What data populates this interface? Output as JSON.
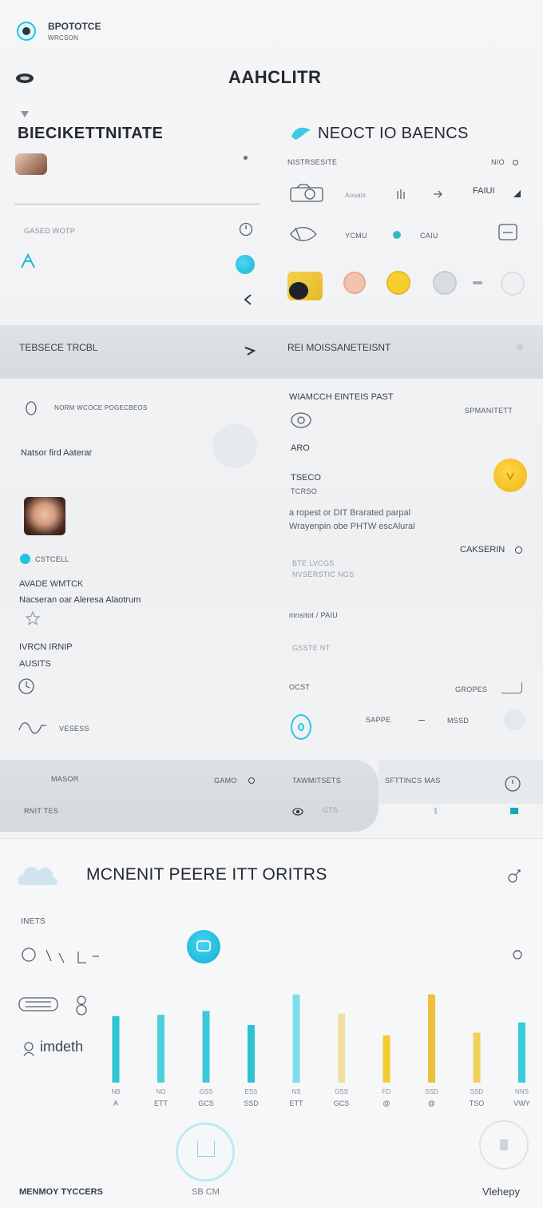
{
  "app": {
    "logo_title": "BPOTOTCE",
    "logo_subtitle": "WRCSON",
    "window_title": "AAHCLITR"
  },
  "left_panel": {
    "title": "BIECIKETTNITATE",
    "row1_label": "GASED WOTP",
    "band_label": "TEBSECE TRCBL",
    "row_a_label": "NORM WCOCE POGECBEOS",
    "section_label": "Natsor fird Aaterar",
    "status_label": "CSTCELL",
    "item_title": "AVADE WMTCK",
    "item_desc": "Nacseran oar Aleresa Alaotrum",
    "group_title": "IVRCN IRNIP",
    "group_sub": "AUSITS",
    "wave_label": "VESESS"
  },
  "right_panel": {
    "title": "NEOCT IO BAENCS",
    "header_left": "NISTRSESITE",
    "header_right": "NIO",
    "row1_mid": "Aouals",
    "row1_right": "FAIUI",
    "row2_mid": "YCMU",
    "row2_right": "CAIU",
    "band_label": "REI MOISSANETEISNT",
    "section_title": "WIAMCCH EINTEIS PAST",
    "section_right": "SPMANITETT",
    "sub1": "ARO",
    "sub2": "TSECO",
    "sub2b": "TCRSO",
    "desc_line1": "a ropest or DIT Brarated parpal",
    "desc_line2": "Wrayenpin obe PHTW escAlural",
    "status_right": "CAKSERIN",
    "note1": "BTE LVCGS",
    "note1b": "NVSERSTIC NGS",
    "note2": "mnsitot / PAIU",
    "note3": "GSSTE NT",
    "footer_left": "OCST",
    "footer_right": "GROPES",
    "action1": "SAPPE",
    "action2": "MSSD"
  },
  "bottom_bar": {
    "left_label": "MASOR",
    "left_value": "GAMO",
    "left_sub": "RNIT TES",
    "mid_label": "TAWMITSETS",
    "mid_sub": "GTS",
    "right_label": "SFTTINCS MAS"
  },
  "report": {
    "title": "MCNENIT PEERE ITT ORITRS",
    "section_label": "INETS",
    "legend_label": "imdeth",
    "footer_left": "MENMOY TYCCERS",
    "footer_mid": "SB CM",
    "footer_right": "Vlehepy"
  },
  "chart_data": {
    "type": "bar",
    "categories": [
      "NB",
      "NO",
      "GSS",
      "ESS",
      "NS",
      "GSS",
      "FD",
      "SSD",
      "SSD",
      "NNS"
    ],
    "categories_sub": [
      "A",
      "ETT",
      "GCS",
      "SSD",
      "ETT",
      "GCS",
      "@",
      "@",
      "TSO",
      "VWY"
    ],
    "values": [
      52,
      53,
      56,
      45,
      69,
      54,
      37,
      69,
      39,
      47
    ],
    "ylim": [
      0,
      100
    ],
    "colors": [
      "#2cc6d4",
      "#4bcfdc",
      "#3ac9d6",
      "#2cc2d0",
      "#7fdcec",
      "#f0dfa0",
      "#f3cd2f",
      "#efc13a",
      "#f1d157",
      "#3acbd8"
    ]
  },
  "colors": {
    "accent_cyan": "#21c3e0",
    "accent_yellow": "#f6c21a",
    "band_gray": "#d9dee3"
  }
}
